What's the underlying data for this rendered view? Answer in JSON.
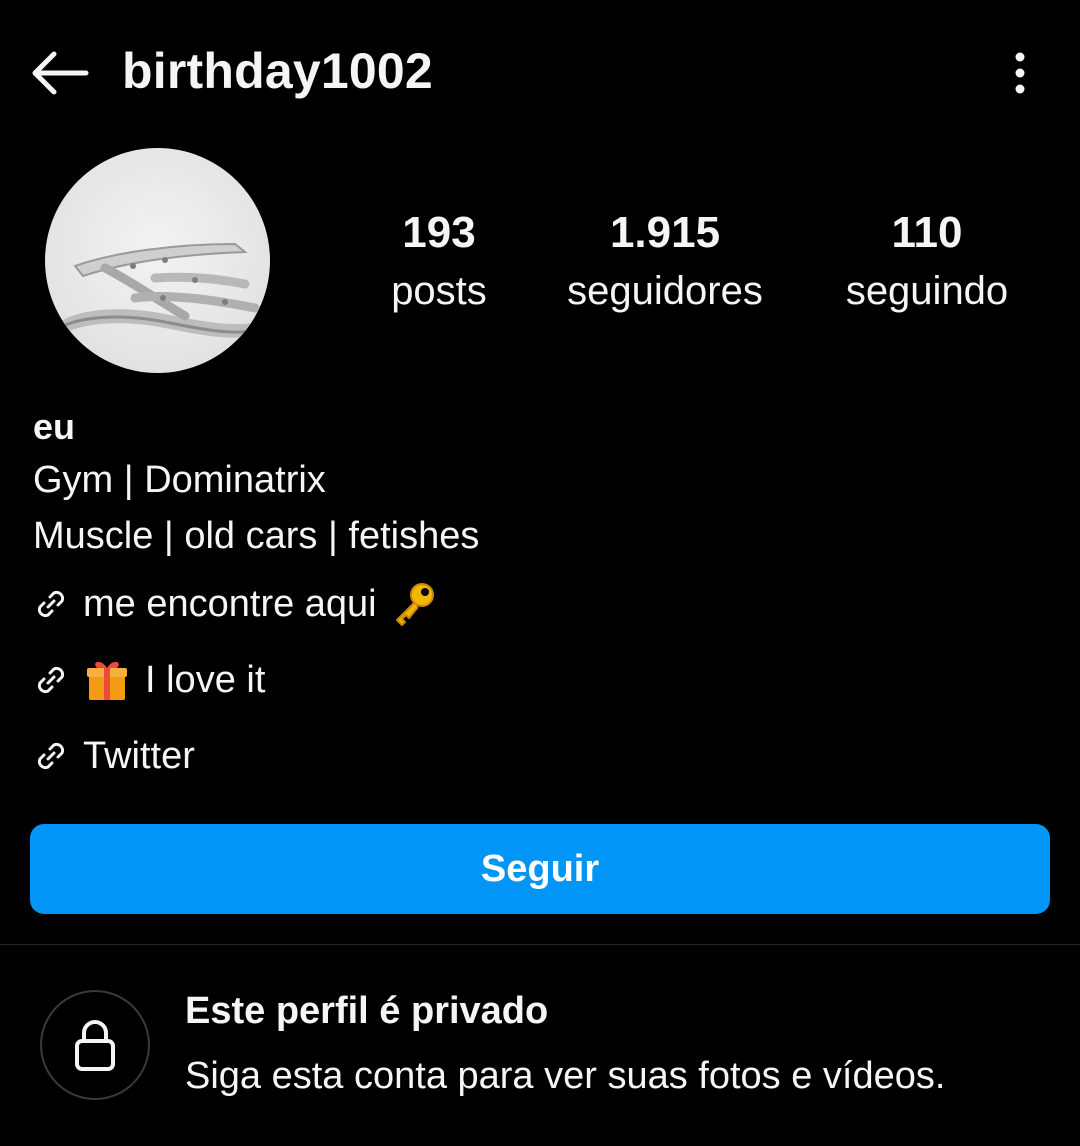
{
  "header": {
    "username": "birthday1002"
  },
  "profile": {
    "avatar_icon": "sandal-photo"
  },
  "stats": {
    "posts_count": "193",
    "posts_label": "posts",
    "followers_count": "1.915",
    "followers_label": "seguidores",
    "following_count": "110",
    "following_label": "seguindo"
  },
  "bio": {
    "name": "eu",
    "line1": "Gym | Dominatrix",
    "line2": "Muscle | old cars | fetishes"
  },
  "links": [
    {
      "text": "me encontre aqui",
      "emoji_after": "key-icon"
    },
    {
      "text": "I love it",
      "emoji_before": "gift-icon"
    },
    {
      "text": "Twitter"
    }
  ],
  "actions": {
    "follow_label": "Seguir",
    "follow_color": "#0095f6"
  },
  "private": {
    "title": "Este perfil é privado",
    "subtitle": "Siga esta conta para ver suas fotos e vídeos."
  },
  "colors": {
    "background": "#000000",
    "text": "#f5f5f5",
    "divider": "#262626"
  }
}
